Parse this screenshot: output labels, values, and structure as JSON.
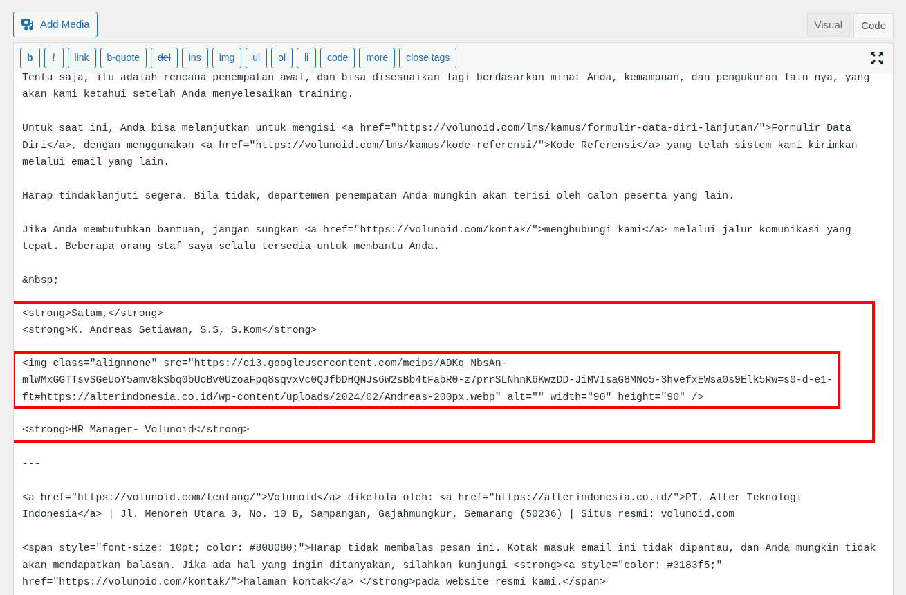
{
  "add_media_button": {
    "label": "Add Media"
  },
  "tabs": [
    {
      "label": "Visual",
      "selected": false
    },
    {
      "label": "Code",
      "selected": true
    }
  ],
  "toolbar_buttons": [
    {
      "label": "b",
      "kind": "bold"
    },
    {
      "label": "i",
      "kind": "italic"
    },
    {
      "label": "link",
      "kind": "link"
    },
    {
      "label": "b-quote",
      "kind": "plain"
    },
    {
      "label": "del",
      "kind": "strike"
    },
    {
      "label": "ins",
      "kind": "plain"
    },
    {
      "label": "img",
      "kind": "plain"
    },
    {
      "label": "ul",
      "kind": "plain"
    },
    {
      "label": "ol",
      "kind": "plain"
    },
    {
      "label": "li",
      "kind": "plain"
    },
    {
      "label": "code",
      "kind": "plain"
    },
    {
      "label": "more",
      "kind": "plain"
    },
    {
      "label": "close tags",
      "kind": "plain"
    }
  ],
  "content": [
    {
      "kind": "text",
      "lines": [
        "Tentu saja, itu adalah rencana penempatan awal, dan bisa disesuaikan lagi berdasarkan minat Anda, kemampuan, dan pengukuran lain nya, yang",
        "akan kami ketahui setelah Anda menyelesaikan training."
      ]
    },
    {
      "kind": "text",
      "lines": [
        "Untuk saat ini, Anda bisa melanjutkan untuk mengisi <a href=\"https://volunoid.com/lms/kamus/formulir-data-diri-lanjutan/\">Formulir Data",
        "Diri</a>, dengan menggunakan <a href=\"https://volunoid.com/lms/kamus/kode-referensi/\">Kode Referensi</a> yang telah sistem kami kirimkan",
        "melalui email yang lain."
      ]
    },
    {
      "kind": "text",
      "lines": [
        "Harap tindaklanjuti segera. Bila tidak, departemen penempatan Anda mungkin akan terisi oleh calon peserta yang lain."
      ]
    },
    {
      "kind": "text",
      "lines": [
        "Jika Anda membutuhkan bantuan, jangan sungkan <a href=\"https://volunoid.com/kontak/\">menghubungi kami</a> melalui jalur komunikasi yang",
        "tepat. Beberapa orang staf saya selalu tersedia untuk membantu Anda."
      ]
    },
    {
      "kind": "text",
      "lines": [
        "&nbsp;"
      ]
    },
    {
      "kind": "highlight",
      "blocks": [
        {
          "kind": "text",
          "lines": [
            "<strong>Salam,</strong>",
            "<strong>K. Andreas Setiawan, S.S, S.Kom</strong>"
          ]
        },
        {
          "kind": "highlight",
          "blocks": [
            {
              "kind": "text",
              "lines": [
                "<img class=\"alignnone\" src=\"https://ci3.googleusercontent.com/meips/ADKq_NbsAn-",
                "mlWMxGGTTsvSGeUoY5amv8kSbq0bUoBv0UzoaFpq8sqvxVc0QJfbDHQNJs6W2sBb4tFabR0-z7prrSLNhnK6KwzDD-JiMVIsaG8MNo5-3hvefxEWsa0s9Elk5Rw=s0-d-e1-",
                "ft#https://alterindonesia.co.id/wp-content/uploads/2024/02/Andreas-200px.webp\" alt=\"\" width=\"90\" height=\"90\" />"
              ]
            }
          ]
        },
        {
          "kind": "text",
          "lines": [
            "<strong>HR Manager- Volunoid</strong>"
          ]
        }
      ]
    },
    {
      "kind": "text",
      "lines": [
        "---"
      ]
    },
    {
      "kind": "text",
      "lines": [
        "<a href=\"https://volunoid.com/tentang/\">Volunoid</a> dikelola oleh: <a href=\"https://alterindonesia.co.id/\">PT. Alter Teknologi",
        "Indonesia</a> | Jl. Menoreh Utara 3, No. 10 B, Sampangan, Gajahmungkur, Semarang (50236) | Situs resmi: volunoid.com"
      ]
    },
    {
      "kind": "text",
      "lines": [
        "<span style=\"font-size: 10pt; color: #808080;\">Harap tidak membalas pesan ini. Kotak masuk email ini tidak dipantau, dan Anda mungkin tidak",
        "akan mendapatkan balasan. Jika ada hal yang ingin ditanyakan, silahkan kunjungi <strong><a style=\"color: #3183f5;\"",
        "href=\"https://volunoid.com/kontak/\">halaman kontak</a> </strong>pada website resmi kami.</span>"
      ]
    }
  ]
}
